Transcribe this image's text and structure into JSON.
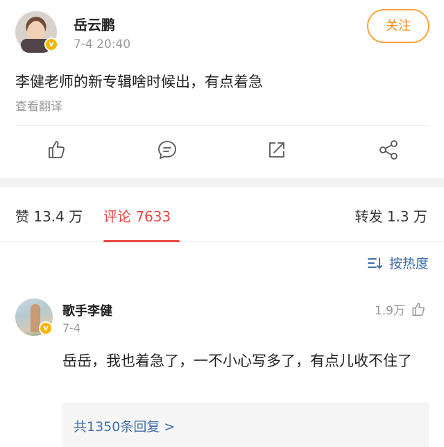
{
  "post": {
    "author": "岳云鹏",
    "time": "7-4 20:40",
    "follow_label": "关注",
    "text": "李健老师的新专辑啥时候出，有点着急",
    "translate_label": "查看翻译"
  },
  "tabs": {
    "likes": "赞 13.4 万",
    "comments": "评论 7633",
    "reposts": "转发 1.3 万"
  },
  "sort": {
    "label": "按热度"
  },
  "comment": {
    "author": "歌手李健",
    "date": "7-4",
    "like_count": "1.9万",
    "text": "岳岳，我也着急了，一不小心写多了，有点儿收不住了",
    "replies_label": "共1350条回复 >"
  },
  "icons": {
    "verified_badge": "verified-badge-icon",
    "like": "thumb-up-icon",
    "comment": "comment-icon",
    "repost": "repost-icon",
    "share": "share-icon",
    "sort": "sort-icon"
  },
  "colors": {
    "accent_orange": "#f08b19",
    "active_red": "#e8473f",
    "link_blue": "#3f6ea9",
    "verified_gold": "#f7b500"
  }
}
